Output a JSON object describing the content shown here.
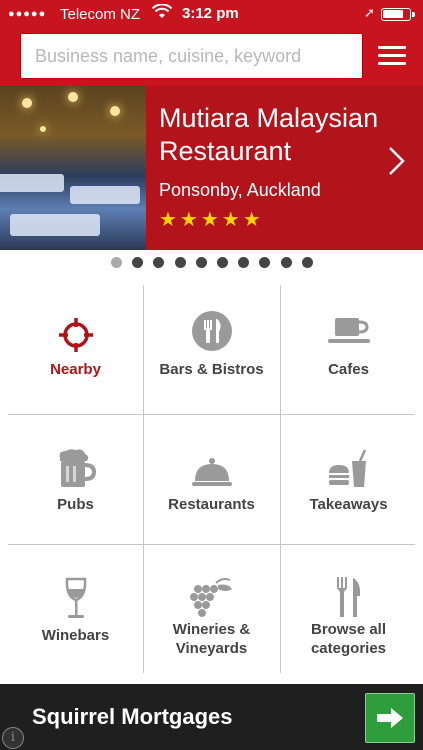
{
  "status_bar": {
    "carrier": "Telecom NZ",
    "time": "3:12 pm"
  },
  "search": {
    "placeholder": "Business name, cuisine, keyword",
    "value": ""
  },
  "hero": {
    "title": "Mutiara Malaysian Restaurant",
    "location": "Ponsonby, Auckland",
    "rating": 5,
    "stars": "★★★★★",
    "slide_count": 10,
    "active_slide": 1
  },
  "categories": [
    {
      "label": "Nearby",
      "icon": "crosshair-icon"
    },
    {
      "label": "Bars & Bistros",
      "icon": "cutlery-icon"
    },
    {
      "label": "Cafes",
      "icon": "coffee-cup-icon"
    },
    {
      "label": "Pubs",
      "icon": "beer-mug-icon"
    },
    {
      "label": "Restaurants",
      "icon": "cloche-icon"
    },
    {
      "label": "Takeaways",
      "icon": "burger-drink-icon"
    },
    {
      "label": "Winebars",
      "icon": "wine-glass-icon"
    },
    {
      "label": "Wineries & Vineyards",
      "icon": "grapes-icon"
    },
    {
      "label": "Browse all categories",
      "icon": "fork-knife-icon"
    }
  ],
  "ad": {
    "text": "Squirrel Mortgages",
    "info": "i"
  },
  "colors": {
    "brand_red": "#c8141e",
    "hero_red": "#b3131a",
    "star_yellow": "#ffd400",
    "ad_green": "#2e9e3c"
  }
}
